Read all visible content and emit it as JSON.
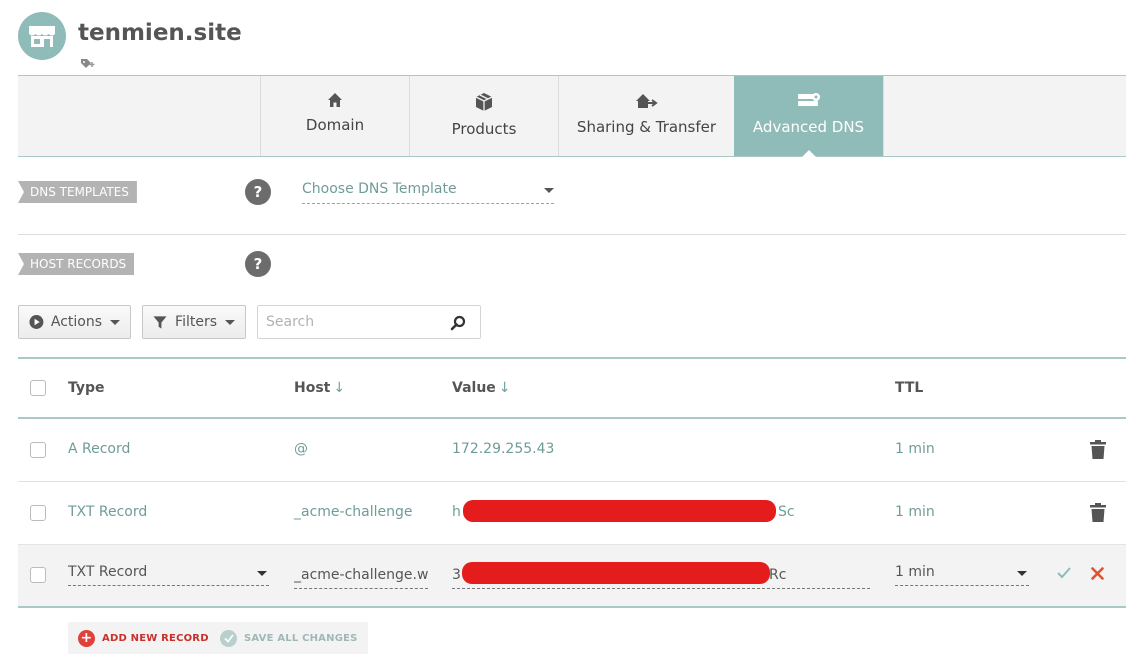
{
  "site": {
    "title": "tenmien.site"
  },
  "tabs": [
    {
      "label": "Domain",
      "icon": "home-icon"
    },
    {
      "label": "Products",
      "icon": "box-icon"
    },
    {
      "label": "Sharing & Transfer",
      "icon": "transfer-icon"
    },
    {
      "label": "Advanced DNS",
      "icon": "dns-icon",
      "active": true
    }
  ],
  "dns_templates": {
    "label": "DNS TEMPLATES",
    "help": "?",
    "select_value": "Choose DNS Template"
  },
  "host_records": {
    "label": "HOST RECORDS",
    "help": "?"
  },
  "toolbar": {
    "actions_label": "Actions",
    "filters_label": "Filters",
    "search_placeholder": "Search"
  },
  "table": {
    "headers": {
      "type": "Type",
      "host": "Host",
      "value": "Value",
      "ttl": "TTL",
      "sort_arrow": "↓"
    },
    "rows": [
      {
        "type": "A Record",
        "host": "@",
        "value": "172.29.255.43",
        "ttl": "1 min"
      },
      {
        "type": "TXT Record",
        "host": "_acme-challenge",
        "value_start": "h",
        "value_end": "Sc",
        "ttl": "1 min"
      }
    ],
    "edit_row": {
      "type": "TXT Record",
      "host": "_acme-challenge.wv",
      "value_start": "3",
      "value_end": "Rc",
      "ttl": "1 min"
    }
  },
  "bottom": {
    "add_label": "ADD NEW RECORD",
    "save_label": "SAVE ALL CHANGES"
  },
  "colors": {
    "accent": "#8fbcb9",
    "link": "#6f9c99",
    "danger": "#e5512f",
    "redaction": "#e51c1c"
  }
}
